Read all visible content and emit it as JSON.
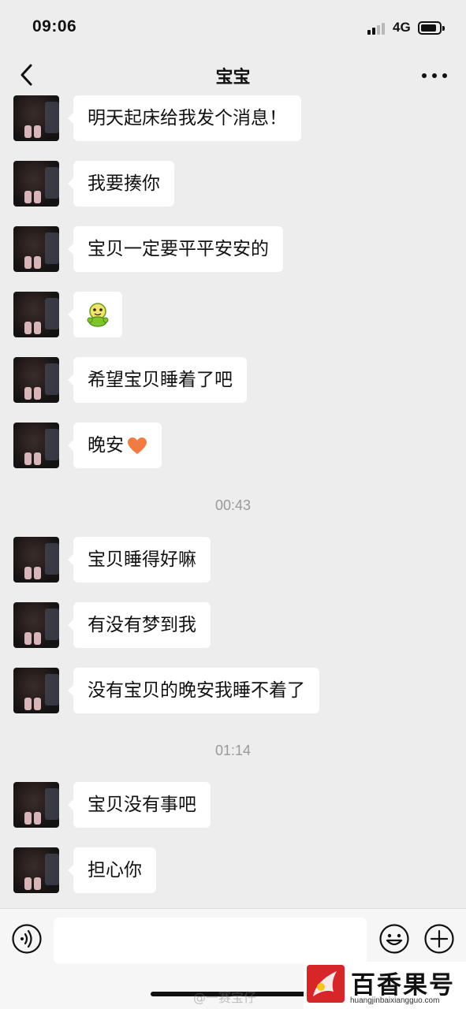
{
  "status_bar": {
    "time": "09:06",
    "network": "4G"
  },
  "header": {
    "title": "宝宝"
  },
  "messages": [
    {
      "text": "明天起床给我发个消息！"
    },
    {
      "text": "我要揍你"
    },
    {
      "text": "宝贝一定要平平安安的"
    },
    {
      "text": "",
      "emoji": "green-smiley-sticker"
    },
    {
      "text": "希望宝贝睡着了吧"
    },
    {
      "text": "晚安",
      "emoji": "orange-heart"
    },
    {
      "text": "宝贝睡得好嘛"
    },
    {
      "text": "有没有梦到我"
    },
    {
      "text": "没有宝贝的晚安我睡不着了"
    },
    {
      "text": "宝贝没有事吧"
    },
    {
      "text": "担心你"
    }
  ],
  "timestamps": [
    "00:43",
    "01:14"
  ],
  "input_bar": {
    "placeholder": ""
  },
  "watermarks": {
    "weibo": "@一赛宝仔",
    "site_name": "百香果号",
    "site_url": "huangjinbaixiangguo.com"
  },
  "colors": {
    "background": "#ededed",
    "bubble": "#ffffff",
    "heart": "#f07c44",
    "sticker": "#7ec42a",
    "logo": "#d6262a"
  }
}
